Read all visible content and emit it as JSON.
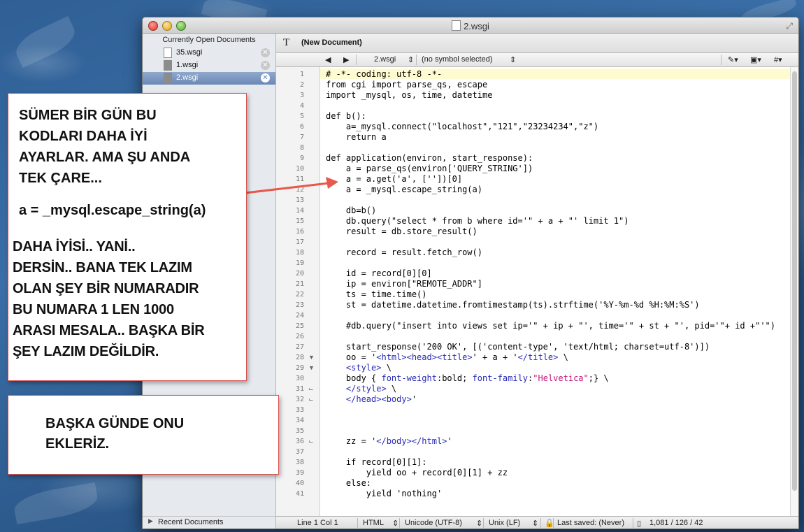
{
  "window": {
    "title": "2.wsgi"
  },
  "sidebar": {
    "header": "Currently Open Documents",
    "documents": [
      {
        "name": "35.wsgi"
      },
      {
        "name": "1.wsgi"
      },
      {
        "name": "2.wsgi"
      }
    ],
    "recent": "Recent Documents",
    "footer": {
      "add": "+",
      "gear": "✲▾",
      "view": "▭",
      "grip": "|||"
    }
  },
  "toolbar": {
    "text_tool": "T",
    "document_label": "(New Document)",
    "nav_back": "◀",
    "nav_forward": "▶",
    "file_menu": "2.wsgi",
    "symbol_menu": "(no symbol selected)",
    "right_tools": [
      "✎▾",
      "▣▾",
      "#▾"
    ]
  },
  "code": {
    "lines": [
      "# -*- coding: utf-8 -*-",
      "from cgi import parse_qs, escape",
      "import _mysql, os, time, datetime",
      "",
      "def b():",
      "    a=_mysql.connect(\"localhost\",\"121\",\"23234234\",\"z\")",
      "    return a",
      "",
      "def application(environ, start_response):",
      "    a = parse_qs(environ['QUERY_STRING'])",
      "    a = a.get('a', [''])[0]",
      "    a = _mysql.escape_string(a)",
      "",
      "    db=b()",
      "    db.query(\"select * from b where id='\" + a + \"' limit 1\")",
      "    result = db.store_result()",
      "",
      "    record = result.fetch_row()",
      "",
      "    id = record[0][0]",
      "    ip = environ[\"REMOTE_ADDR\"]",
      "    ts = time.time()",
      "    st = datetime.datetime.fromtimestamp(ts).strftime('%Y-%m-%d %H:%M:%S')",
      "",
      "    #db.query(\"insert into views set ip='\" + ip + \"', time='\" + st + \"', pid='\"+ id +\"'\")",
      "",
      "    start_response('200 OK', [('content-type', 'text/html; charset=utf-8')])",
      "    oo = '<html><head><title>' + a + '</title> \\",
      "    <style> \\",
      "    body { font-weight:bold; font-family:\"Helvetica\";} \\",
      "    </style> \\",
      "    </head><body>'",
      "",
      "",
      "",
      "    zz = '</body></html>'",
      "",
      "    if record[0][1]:",
      "        yield oo + record[0][1] + zz",
      "    else:",
      "        yield 'nothing'"
    ],
    "fold_markers": {
      "28": "▼",
      "29": "▼",
      "31": "⌙",
      "32": "⌙",
      "36": "⌙"
    }
  },
  "status_bar": {
    "position": "Line 1 Col 1",
    "language": "HTML",
    "encoding": "Unicode (UTF-8)",
    "line_endings": "Unix (LF)",
    "last_saved": "Last saved: (Never)",
    "stats": "1,081 / 126 / 42"
  },
  "annotations": {
    "note1_para1": "SÜMER BİR GÜN BU\nKODLARI DAHA İYİ\nAYARLAR. AMA ŞU ANDA\nTEK ÇARE...",
    "note1_code": "a = _mysql.escape_string(a)",
    "note1_para2": "DAHA İYİSİ.. YANİ..\nDERSİN.. BANA TEK LAZIM\nOLAN ŞEY BİR NUMARADIR\nBU NUMARA 1 LEN 1000\nARASI MESALA.. BAŞKA BİR\nŞEY LAZIM DEĞİLDİR.",
    "note2_text": "BAŞKA GÜNDE ONU\nEKLERİZ.",
    "arrow_color": "#e8584b",
    "border_color": "#d9534f"
  }
}
